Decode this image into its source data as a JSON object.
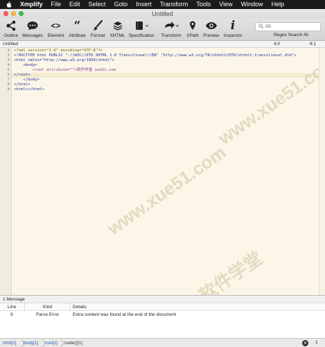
{
  "menubar": {
    "app": "Xmplify",
    "items": [
      "File",
      "Edit",
      "Select",
      "Goto",
      "Insert",
      "Transform",
      "Tools",
      "View",
      "Window",
      "Help"
    ]
  },
  "window": {
    "title": "Untitled"
  },
  "toolbar": {
    "outline": "Outline",
    "messages": "Messages",
    "element": "Element",
    "attribute": "Attribute",
    "format": "Format",
    "xhtml": "XHTML",
    "specification": "Specification",
    "transform": "Transform",
    "xpath": "XPath",
    "preview": "Preview",
    "inspector": "Inspector",
    "search_placeholder": "All",
    "search_label": "Regex Search All"
  },
  "document": {
    "name": "Untitled",
    "cursor": "4:0",
    "selection": "6:1",
    "lines": [
      "1",
      "2",
      "3",
      "4",
      "5",
      "6",
      "7",
      "8",
      "9"
    ],
    "code": [
      "<?xml version=\"1.0\" encoding=\"UTF-8\"?>",
      "<!DOCTYPE html PUBLIC \"-//W3C//DTD XHTML 1.0 Transitional//EN\" \"http://www.w3.org/TR/xhtml1/DTD/xhtml1-transitional.dtd\">",
      "<html xmlns=\"http://www.w3.org/1999/xhtml\">",
      "    <body>",
      "        <root attribute=\"\">软件学堂 xue51.com",
      "</root>",
      "    </body>",
      "</html>",
      "<html></html>"
    ]
  },
  "watermark": [
    "软件学堂",
    "www.xue51.com"
  ],
  "messages": {
    "header": "1 Message",
    "columns": {
      "line": "Line",
      "kind": "Kind",
      "details": "Details"
    },
    "rows": [
      {
        "line": "9",
        "kind": "Parse Error",
        "details": "Extra content was found at the end of the document"
      }
    ]
  },
  "statusbar": {
    "crumbs": [
      "html[1]",
      "body[1]",
      "root[1]",
      "node()[1]"
    ],
    "error_count": "1"
  }
}
